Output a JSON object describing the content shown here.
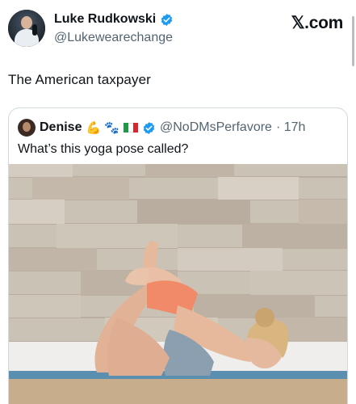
{
  "tweet": {
    "author_name": "Luke Rudkowski",
    "author_handle": "@Lukewearechange",
    "site_label": "𝕏.com",
    "text": "The American taxpayer"
  },
  "quoted_tweet": {
    "author_name": "Denise",
    "emojis": "💪 🐾",
    "author_handle": "@NoDMsPerfavore",
    "time": "· 17h",
    "text": "What’s this yoga pose called?"
  },
  "colors": {
    "verified_blue": "#1d9bf0",
    "handle_gray": "#536471",
    "border": "#cfd9de"
  }
}
